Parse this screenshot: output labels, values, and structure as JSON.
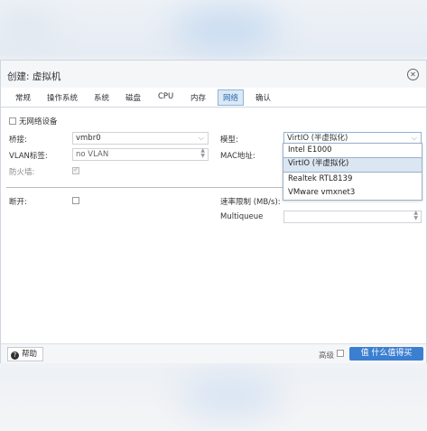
{
  "dialog": {
    "title": "创建: 虚拟机",
    "tabs": [
      {
        "label": "常规"
      },
      {
        "label": "操作系统"
      },
      {
        "label": "系统"
      },
      {
        "label": "磁盘"
      },
      {
        "label": "CPU"
      },
      {
        "label": "内存"
      },
      {
        "label": "网络"
      },
      {
        "label": "确认"
      }
    ],
    "active_tab": "网络"
  },
  "form": {
    "no_network_label": "无网络设备",
    "bridge_label": "桥接:",
    "bridge_value": "vmbr0",
    "vlan_label": "VLAN标签:",
    "vlan_value": "no VLAN",
    "firewall_label": "防火墙:",
    "model_label": "模型:",
    "model_value": "VirtIO (半虚拟化)",
    "mac_label": "MAC地址:",
    "disconnect_label": "断开:",
    "rate_label": "速率限制 (MB/s):",
    "multiqueue_label": "Multiqueue"
  },
  "model_options": [
    "Intel E1000",
    "VirtIO (半虚拟化)",
    "Realtek RTL8139",
    "VMware vmxnet3"
  ],
  "model_selected_index": 1,
  "footer": {
    "help_label": "帮助",
    "advanced_label": "高级",
    "watermark": "值 什么值得买"
  }
}
